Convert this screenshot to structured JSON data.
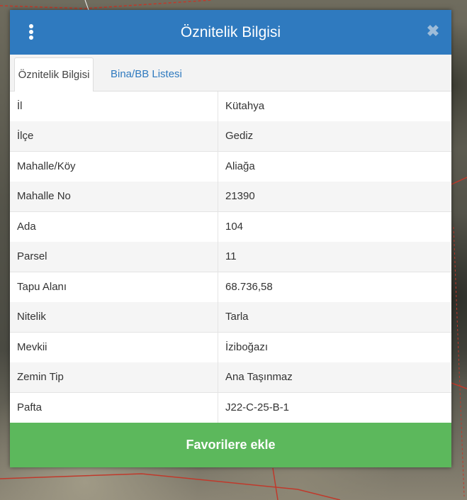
{
  "dialog": {
    "title": "Öznitelik Bilgisi",
    "close_symbol": "✖",
    "menu_icon": "vertical-dots-icon"
  },
  "tabs": [
    {
      "label": "Öznitelik Bilgisi",
      "active": true
    },
    {
      "label": "Bina/BB Listesi",
      "active": false
    }
  ],
  "attributes": [
    {
      "key": "İl",
      "value": "Kütahya"
    },
    {
      "key": "İlçe",
      "value": "Gediz"
    },
    {
      "key": "Mahalle/Köy",
      "value": "Aliağa"
    },
    {
      "key": "Mahalle No",
      "value": "21390"
    },
    {
      "key": "Ada",
      "value": "104"
    },
    {
      "key": "Parsel",
      "value": "11"
    },
    {
      "key": "Tapu Alanı",
      "value": "68.736,58"
    },
    {
      "key": "Nitelik",
      "value": "Tarla"
    },
    {
      "key": "Mevkii",
      "value": "İziboğazı"
    },
    {
      "key": "Zemin Tip",
      "value": "Ana Taşınmaz"
    },
    {
      "key": "Pafta",
      "value": "J22-C-25-B-1"
    }
  ],
  "footer": {
    "favorite_label": "Favorilere ekle"
  },
  "colors": {
    "header": "#2f7abf",
    "favorite_button": "#5cb85c"
  }
}
